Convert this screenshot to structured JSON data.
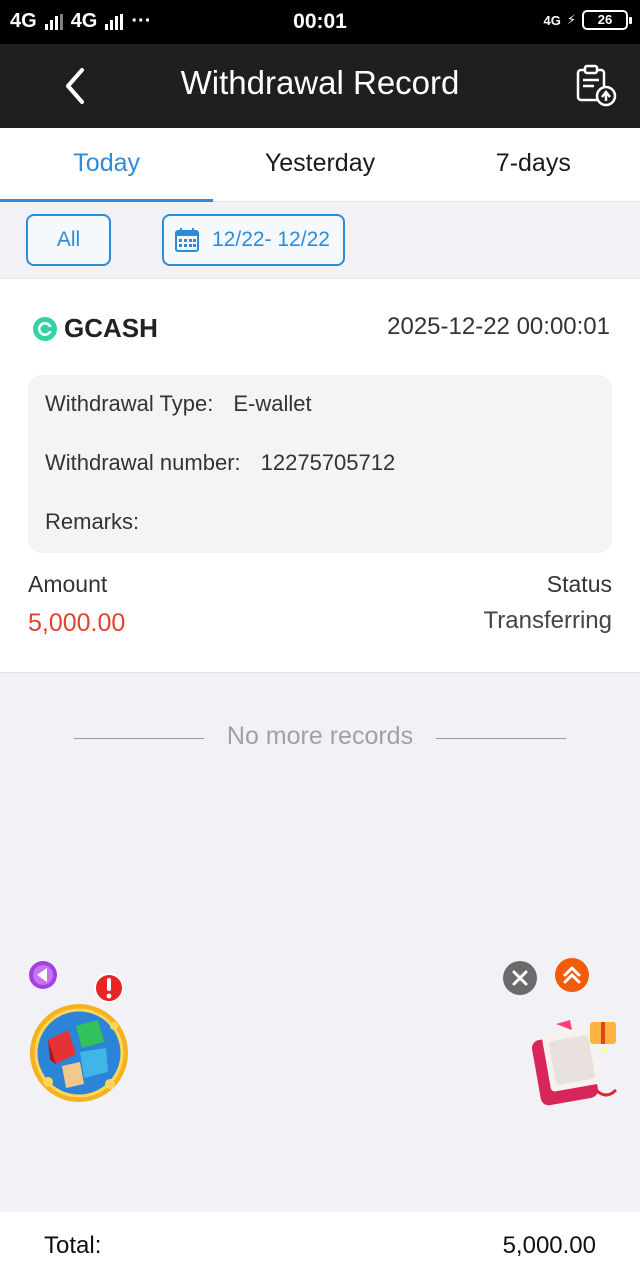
{
  "status_bar": {
    "network1": "4G",
    "network2": "4G",
    "dots": "···",
    "time": "00:01",
    "network_small": "4G",
    "battery": "26"
  },
  "header": {
    "title": "Withdrawal Record",
    "back_icon": "chevron-left-icon",
    "action_icon": "clipboard-upload-icon"
  },
  "tabs": [
    {
      "label": "Today",
      "active": true
    },
    {
      "label": "Yesterday",
      "active": false
    },
    {
      "label": "7-days",
      "active": false
    }
  ],
  "filter": {
    "all_label": "All",
    "date_range": "12/22- 12/22"
  },
  "record": {
    "provider": "GCASH",
    "datetime": "2025-12-22 00:00:01",
    "withdrawal_type_label": "Withdrawal Type:",
    "withdrawal_type_value": "E-wallet",
    "withdrawal_number_label": "Withdrawal number:",
    "withdrawal_number_value": "12275705712",
    "remarks_label": "Remarks:",
    "remarks_value": "",
    "amount_label": "Amount",
    "amount_value": "5,000.00",
    "status_label": "Status",
    "status_value": "Transferring"
  },
  "list_end": "No more records",
  "footer": {
    "total_label": "Total:",
    "total_value": "5,000.00"
  },
  "colors": {
    "accent": "#2f8bd6",
    "amount": "#e0432b",
    "header_bg": "#1e1f21"
  }
}
